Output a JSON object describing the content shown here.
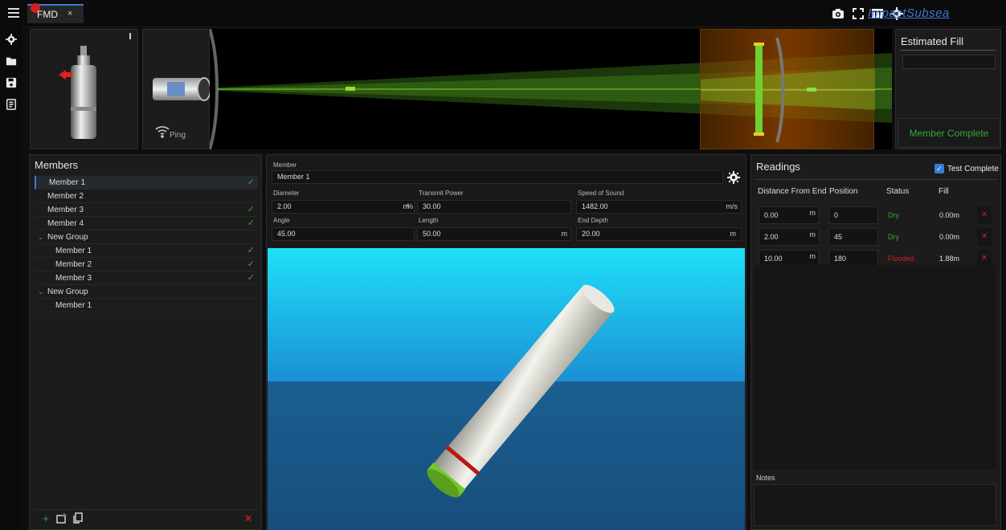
{
  "window": {
    "tab_label": "FMD",
    "tab_close": "×",
    "brand": "ImpactSubsea"
  },
  "toolbar_icons": [
    "camera-icon",
    "fullscreen-icon",
    "layout-icon",
    "gear-icon"
  ],
  "rail_icons": [
    "gear-icon",
    "folder-icon",
    "save-icon",
    "report-icon"
  ],
  "sensor": {
    "ping_label": "Ping"
  },
  "estimated_fill": {
    "title": "Estimated Fill",
    "value": "",
    "member_complete_label": "Member Complete"
  },
  "members": {
    "title": "Members",
    "rows": [
      {
        "label": "Member 1",
        "level": 0,
        "complete": true,
        "selected": true
      },
      {
        "label": "Member 2",
        "level": 0,
        "complete": false
      },
      {
        "label": "Member 3",
        "level": 0,
        "complete": true
      },
      {
        "label": "Member 4",
        "level": 0,
        "complete": true
      },
      {
        "label": "New Group",
        "level": 0,
        "group": true
      },
      {
        "label": "Member 1",
        "level": 1,
        "complete": true
      },
      {
        "label": "Member 2",
        "level": 1,
        "complete": true
      },
      {
        "label": "Member 3",
        "level": 1,
        "complete": true
      },
      {
        "label": "New Group",
        "level": 0,
        "group": true
      },
      {
        "label": "Member 1",
        "level": 1,
        "complete": false
      }
    ],
    "check_glyph": "✓",
    "group_arrow": "⌄"
  },
  "form": {
    "member_label": "Member",
    "member_value": "Member 1",
    "diameter_label": "Diameter",
    "diameter_value": "2.00",
    "diameter_unit": "m",
    "transmit_label": "Transmit Power",
    "transmit_value": "30.00",
    "transmit_unit": "%",
    "sos_label": "Speed of Sound",
    "sos_value": "1482.00",
    "sos_unit": "m/s",
    "angle_label": "Angle",
    "angle_value": "45.00",
    "angle_unit": "°",
    "length_label": "Length",
    "length_value": "50.00",
    "length_unit": "m",
    "end_depth_label": "End Depth",
    "end_depth_value": "20.00",
    "end_depth_unit": "m"
  },
  "readings": {
    "title": "Readings",
    "test_complete_label": "Test Complete",
    "test_complete_checked": true,
    "headers": [
      "Distance From End",
      "Position",
      "Status",
      "Fill"
    ],
    "rows": [
      {
        "distance": "0.00",
        "unit": "m",
        "position": "0",
        "status": "Dry",
        "fill": "0.00m"
      },
      {
        "distance": "2.00",
        "unit": "m",
        "position": "45",
        "status": "Dry",
        "fill": "0.00m"
      },
      {
        "distance": "10.00",
        "unit": "m",
        "position": "180",
        "status": "Flooded",
        "fill": "1.88m"
      }
    ],
    "delete_glyph": "✕",
    "notes_label": "Notes"
  },
  "colors": {
    "accent": "#3a7bd5",
    "dry": "#3aa53a",
    "flooded": "#d42020",
    "beam": "#4aa01e",
    "range_box": "#a0520a"
  }
}
